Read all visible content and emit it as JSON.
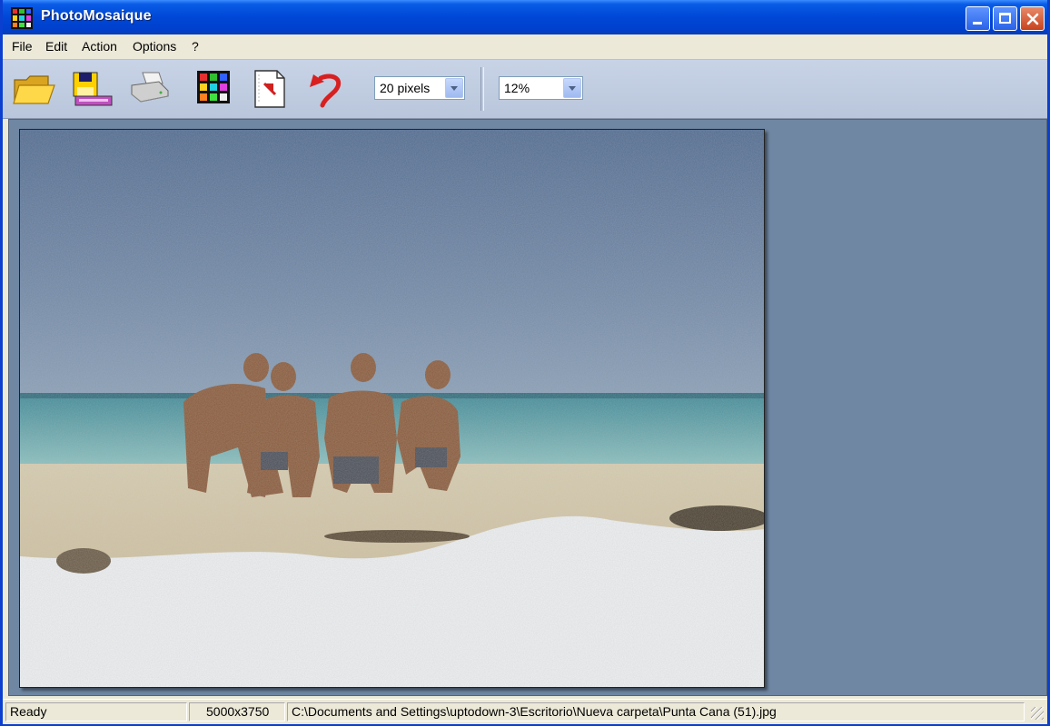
{
  "window": {
    "title": "PhotoMosaique"
  },
  "menu": [
    "File",
    "Edit",
    "Action",
    "Options",
    "?"
  ],
  "toolbar": {
    "buttons": [
      {
        "name": "open-folder-icon"
      },
      {
        "name": "save-disk-icon"
      },
      {
        "name": "printer-icon"
      },
      {
        "name": "mosaic-grid-icon"
      },
      {
        "name": "export-document-icon"
      },
      {
        "name": "undo-arrow-icon"
      }
    ],
    "tile_size": "20 pixels",
    "zoom": "12%"
  },
  "status": {
    "state": "Ready",
    "dimensions": "5000x3750",
    "path": "C:\\Documents and Settings\\uptodown-3\\Escritorio\\Nueva carpeta\\Punta Cana (51).jpg"
  },
  "colors": {
    "workspace_bg": "#6f87a3",
    "title_bar": "#0047d6",
    "toolbar_bg": "#c8d3e6"
  }
}
